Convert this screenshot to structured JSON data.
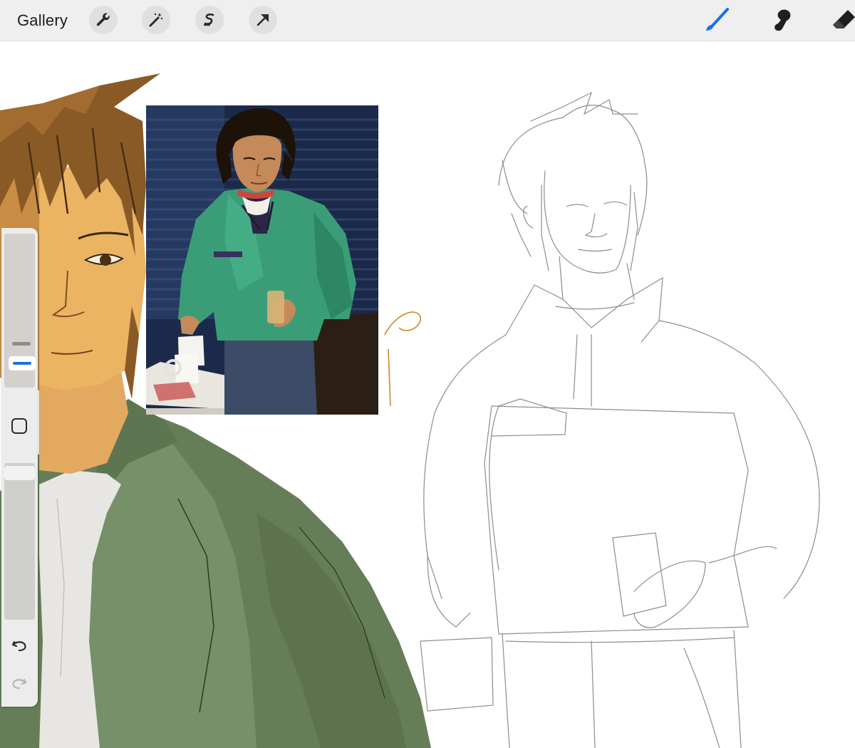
{
  "app": {
    "gallery_label": "Gallery",
    "accent_color": "#1a6fe6",
    "toolbar_left_icons": [
      "wrench-icon",
      "magic-wand-icon",
      "selection-icon",
      "move-arrow-icon"
    ],
    "toolbar_right_icons": [
      "brush-icon",
      "smudge-icon",
      "eraser-icon"
    ],
    "active_tool": "brush"
  },
  "sidebar": {
    "brush_size": 0.72,
    "opacity": 0.95,
    "icons": [
      "modify-square-icon",
      "undo-icon",
      "redo-icon"
    ]
  },
  "canvas": {
    "layers": [
      "painted-portrait",
      "reference-photo",
      "pencil-sketch"
    ]
  }
}
